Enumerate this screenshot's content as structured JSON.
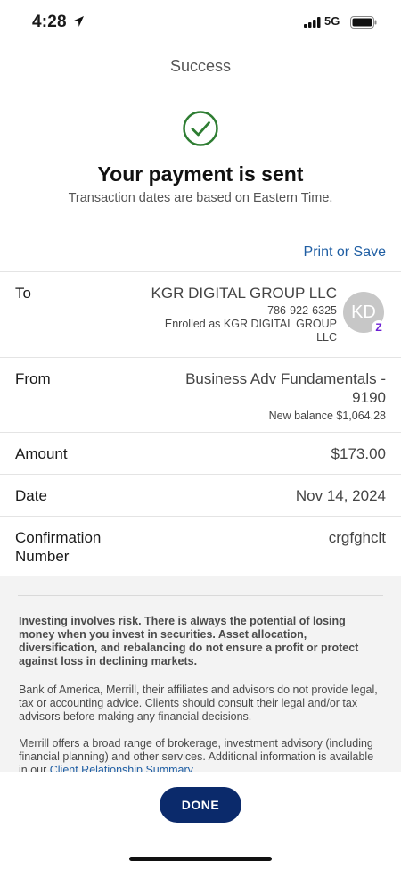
{
  "status_bar": {
    "time": "4:28",
    "network": "5G"
  },
  "nav": {
    "title": "Success"
  },
  "confirmation": {
    "headline": "Your payment is sent",
    "subline": "Transaction dates are based on Eastern Time.",
    "print_save": "Print or Save"
  },
  "details": {
    "to": {
      "label": "To",
      "name": "KGR DIGITAL GROUP LLC",
      "phone": "786-922-6325",
      "enrolled_line1": "Enrolled as KGR DIGITAL GROUP",
      "enrolled_line2": "LLC",
      "avatar_initials": "KD",
      "badge": "Z"
    },
    "from": {
      "label": "From",
      "account_line1": "Business Adv Fundamentals -",
      "account_line2": "9190",
      "balance": "New balance $1,064.28"
    },
    "amount": {
      "label": "Amount",
      "value": "$173.00"
    },
    "date": {
      "label": "Date",
      "value": "Nov 14, 2024"
    },
    "confirmation_number": {
      "label_line1": "Confirmation",
      "label_line2": "Number",
      "value": "crgfghclt"
    }
  },
  "disclosures": {
    "risk": "Investing involves risk. There is always the potential of losing money when you invest in securities. Asset allocation, diversification, and rebalancing do not ensure a profit or protect against loss in declining markets.",
    "advice": "Bank of America, Merrill, their affiliates and advisors do not provide legal, tax or accounting advice. Clients should consult their legal and/or tax advisors before making any financial decisions.",
    "services_text": "Merrill offers a broad range of brokerage, investment advisory (including financial planning) and other services. Additional information is available in our ",
    "services_link": "Client Relationship Summary"
  },
  "actions": {
    "done": "DONE"
  },
  "colors": {
    "link": "#1f5ea3",
    "button": "#0b2a6b",
    "check": "#2e7d32",
    "zelle": "#6d1ed4"
  }
}
